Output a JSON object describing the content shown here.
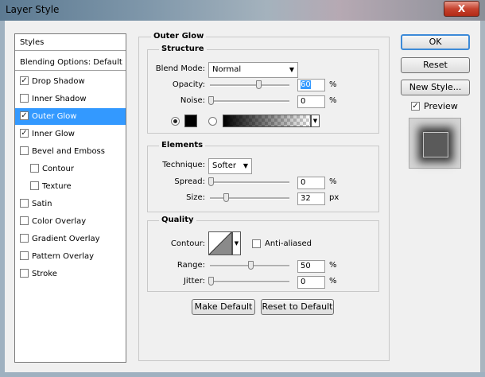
{
  "window": {
    "title": "Layer Style",
    "close_label": "X"
  },
  "styles_list": {
    "header": "Styles",
    "blending": "Blending Options: Default",
    "items": [
      {
        "label": "Drop Shadow",
        "checked": true,
        "selected": false,
        "sub": false
      },
      {
        "label": "Inner Shadow",
        "checked": false,
        "selected": false,
        "sub": false
      },
      {
        "label": "Outer Glow",
        "checked": true,
        "selected": true,
        "sub": false
      },
      {
        "label": "Inner Glow",
        "checked": true,
        "selected": false,
        "sub": false
      },
      {
        "label": "Bevel and Emboss",
        "checked": false,
        "selected": false,
        "sub": false
      },
      {
        "label": "Contour",
        "checked": false,
        "selected": false,
        "sub": true
      },
      {
        "label": "Texture",
        "checked": false,
        "selected": false,
        "sub": true
      },
      {
        "label": "Satin",
        "checked": false,
        "selected": false,
        "sub": false
      },
      {
        "label": "Color Overlay",
        "checked": false,
        "selected": false,
        "sub": false
      },
      {
        "label": "Gradient Overlay",
        "checked": false,
        "selected": false,
        "sub": false
      },
      {
        "label": "Pattern Overlay",
        "checked": false,
        "selected": false,
        "sub": false
      },
      {
        "label": "Stroke",
        "checked": false,
        "selected": false,
        "sub": false
      }
    ]
  },
  "outer_glow": {
    "section_title": "Outer Glow",
    "structure": {
      "title": "Structure",
      "blend_mode_label": "Blend Mode:",
      "blend_mode_value": "Normal",
      "opacity_label": "Opacity:",
      "opacity_value": "60",
      "noise_label": "Noise:",
      "noise_value": "0",
      "percent": "%",
      "glow_color": "#000000"
    },
    "elements": {
      "title": "Elements",
      "technique_label": "Technique:",
      "technique_value": "Softer",
      "spread_label": "Spread:",
      "spread_value": "0",
      "size_label": "Size:",
      "size_value": "32",
      "percent": "%",
      "px": "px"
    },
    "quality": {
      "title": "Quality",
      "contour_label": "Contour:",
      "anti_aliased_label": "Anti-aliased",
      "range_label": "Range:",
      "range_value": "50",
      "jitter_label": "Jitter:",
      "jitter_value": "0",
      "percent": "%"
    },
    "make_default": "Make Default",
    "reset_default": "Reset to Default"
  },
  "buttons": {
    "ok": "OK",
    "reset": "Reset",
    "new_style": "New Style...",
    "preview_label": "Preview",
    "preview_checked": true
  },
  "colors": {
    "selection": "#3399ff",
    "accent_border": "#3c8ad8"
  }
}
